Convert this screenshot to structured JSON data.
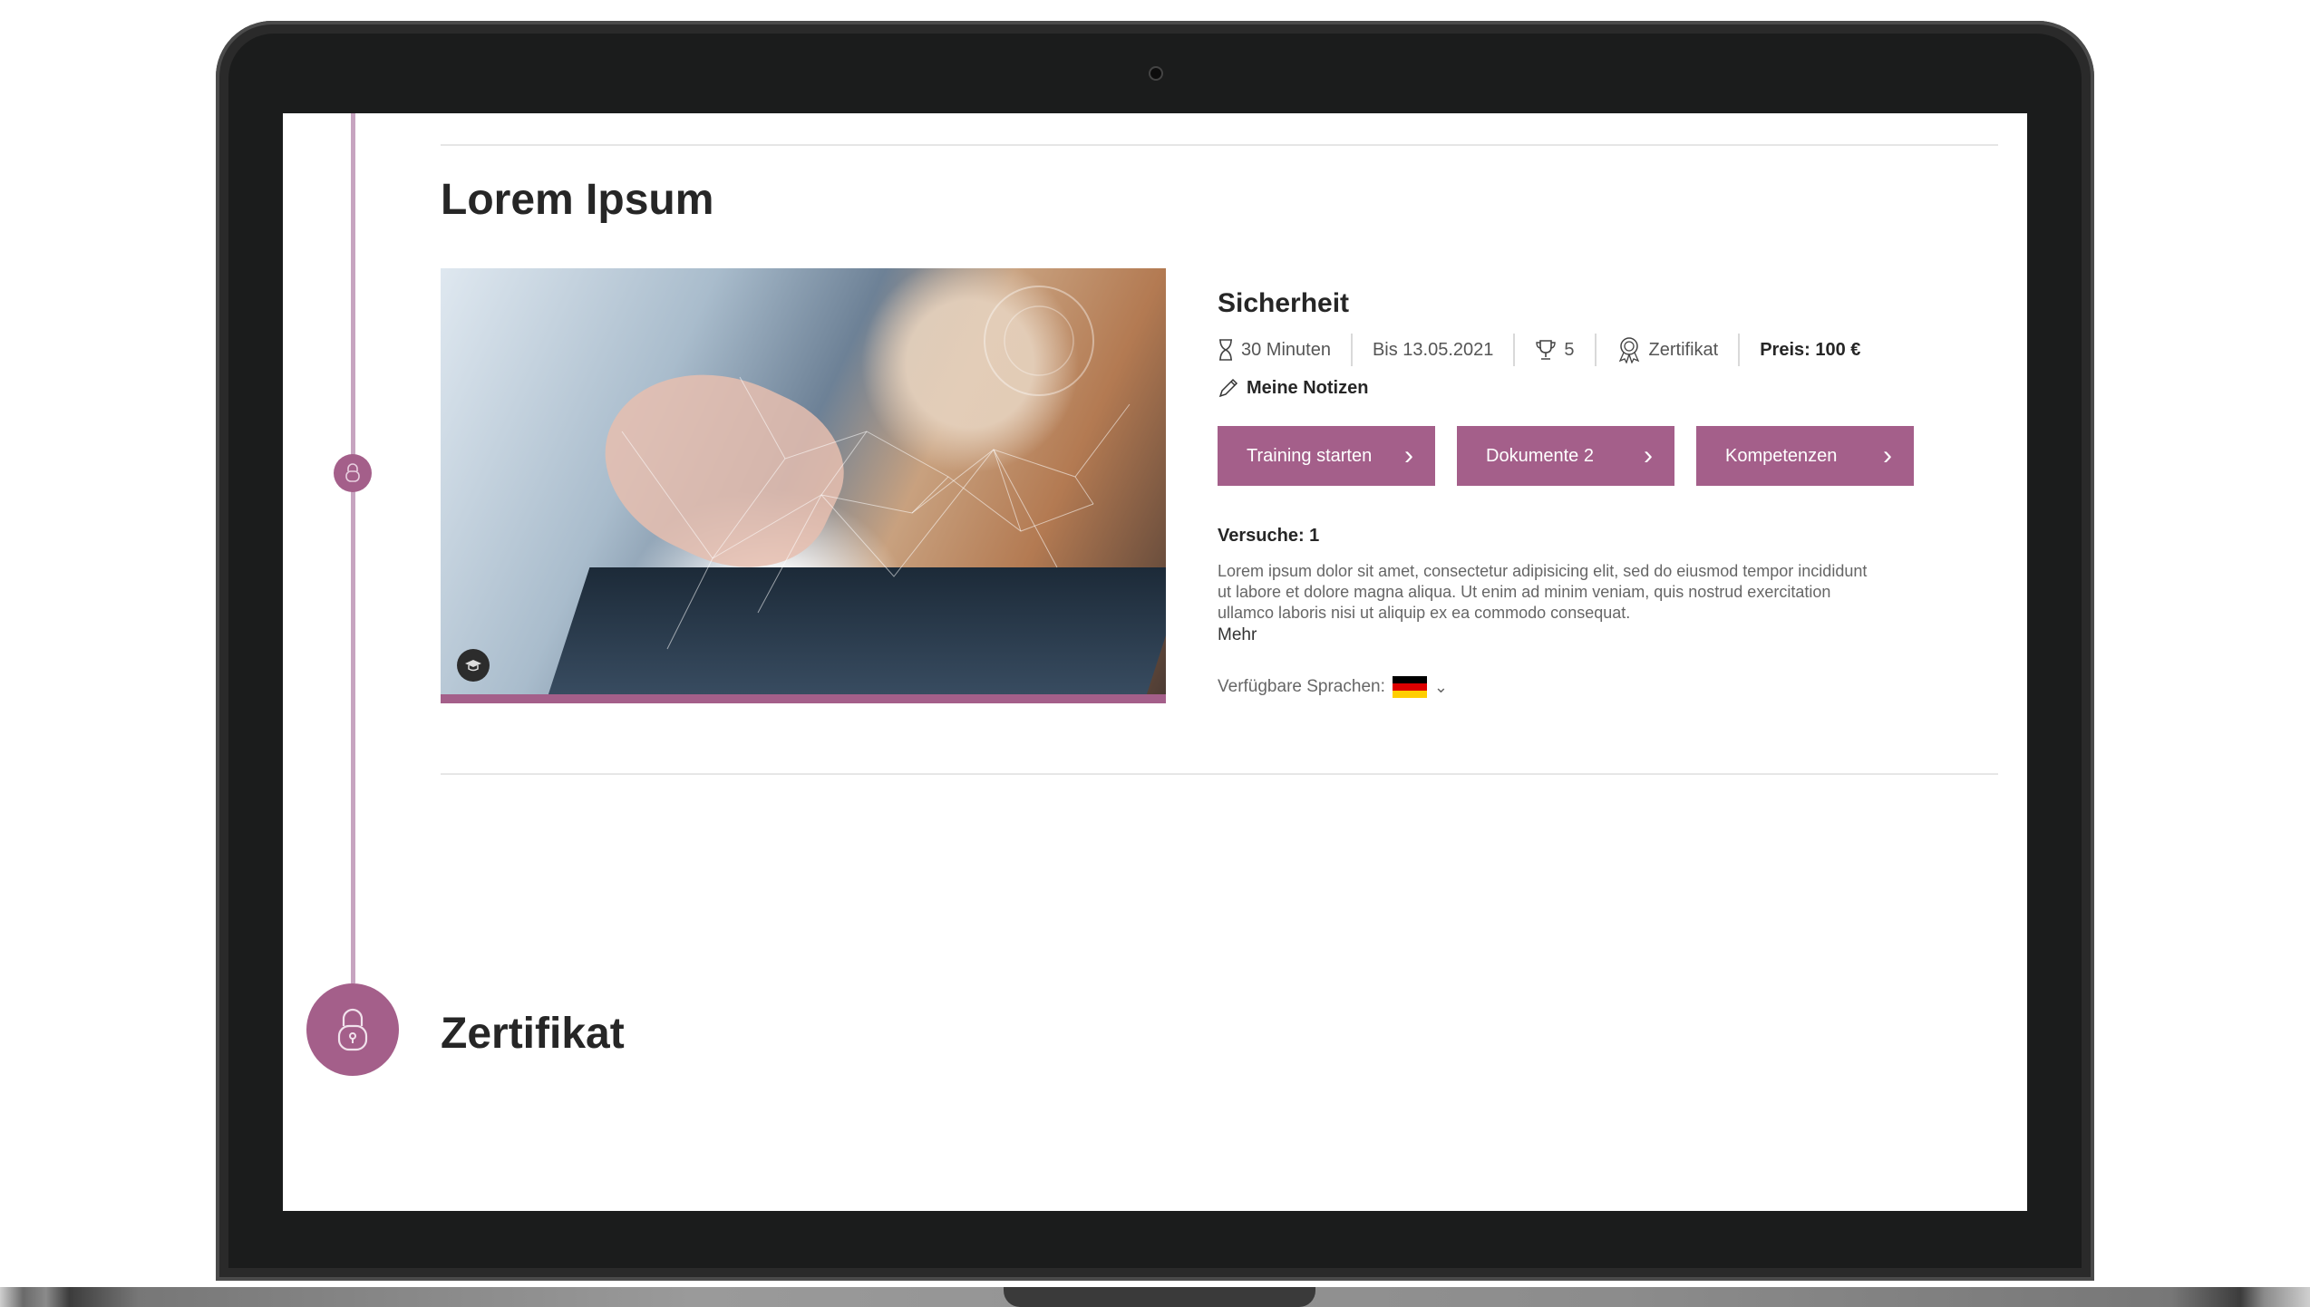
{
  "section_title": "Lorem Ipsum",
  "course": {
    "name": "Sicherheit",
    "duration": "30 Minuten",
    "deadline": "Bis 13.05.2021",
    "trophy_count": "5",
    "certificate": "Zertifikat",
    "price": "Preis: 100 €",
    "notes_label": "Meine Notizen",
    "buttons": {
      "start": "Training starten",
      "documents": "Dokumente 2",
      "competencies": "Kompetenzen"
    },
    "attempts": "Versuche: 1",
    "description": "Lorem ipsum dolor sit amet, consectetur adipisicing elit, sed do eiusmod tempor incididunt ut labore et dolore magna aliqua. Ut enim ad minim veniam, quis nostrud exercitation ullamco laboris nisi ut aliquip ex ea commodo consequat.",
    "more_link": "Mehr",
    "languages_label": "Verfügbare Sprachen:"
  },
  "certificate_section_title": "Zertifikat",
  "colors": {
    "accent": "#a45f8a",
    "timeline": "#c7a4c0",
    "text": "#262626"
  },
  "icons": [
    "hourglass-icon",
    "trophy-icon",
    "certificate-icon",
    "pencil-icon",
    "chevron-right-icon",
    "lock-icon",
    "german-flag-icon",
    "chevron-down-icon"
  ]
}
